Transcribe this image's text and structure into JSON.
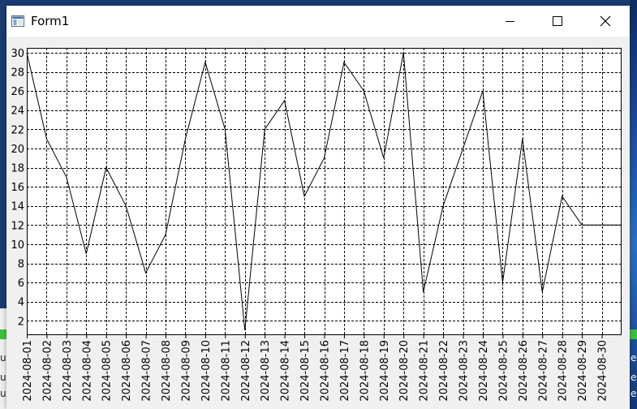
{
  "window": {
    "title": "Form1",
    "minimize_label": "",
    "maximize_label": "",
    "close_label": ""
  },
  "icons": {
    "app": "app-form-icon",
    "minimize": "minimize-icon",
    "maximize": "maximize-icon",
    "close": "close-icon"
  },
  "background_fragments": {
    "left_lines": [
      "u",
      "u",
      "u"
    ],
    "right_lines": [
      "ec",
      "ec",
      "ec"
    ]
  },
  "chart_data": {
    "type": "line",
    "x": [
      "2024-08-01",
      "2024-08-02",
      "2024-08-03",
      "2024-08-04",
      "2024-08-05",
      "2024-08-06",
      "2024-08-07",
      "2024-08-08",
      "2024-08-09",
      "2024-08-10",
      "2024-08-11",
      "2024-08-12",
      "2024-08-13",
      "2024-08-14",
      "2024-08-15",
      "2024-08-16",
      "2024-08-17",
      "2024-08-18",
      "2024-08-19",
      "2024-08-20",
      "2024-08-21",
      "2024-08-22",
      "2024-08-23",
      "2024-08-24",
      "2024-08-25",
      "2024-08-26",
      "2024-08-27",
      "2024-08-28",
      "2024-08-29",
      "2024-08-30"
    ],
    "series": [
      {
        "values": [
          30,
          21,
          17,
          9,
          18,
          14,
          7,
          11,
          21,
          29,
          22,
          1,
          22,
          25,
          15,
          19,
          29,
          26,
          19,
          30,
          5,
          14,
          20,
          26,
          6,
          21,
          5,
          15,
          12,
          12
        ]
      }
    ],
    "title": "",
    "xlabel": "",
    "ylabel": "",
    "ylim": [
      1,
      30
    ],
    "yticks": [
      2,
      4,
      6,
      8,
      10,
      12,
      14,
      16,
      18,
      20,
      22,
      24,
      26,
      28,
      30
    ],
    "grid": true,
    "grid_style": "dashed",
    "line_color": "#000000",
    "plot_background": "#ffffff"
  }
}
